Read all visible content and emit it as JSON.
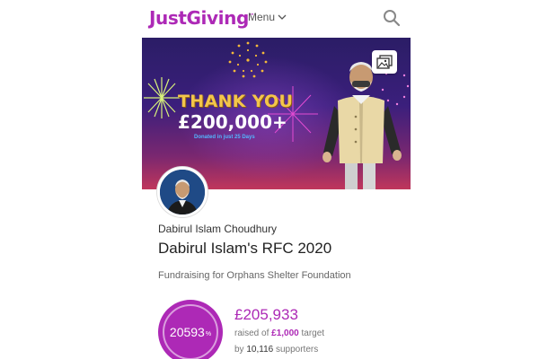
{
  "header": {
    "logo_text": "JustGiving",
    "logo_tm": "™",
    "menu_label": "Menu",
    "brand_color": "#ad29b6",
    "icons": [
      "chevron-down-icon",
      "search-icon"
    ]
  },
  "cover": {
    "headline": "THANK YOU",
    "amount": "£200,000+",
    "note": "Donated in just 25 Days",
    "icons": [
      "gallery-icon"
    ]
  },
  "page": {
    "fundraiser_name": "Dabirul Islam Choudhury",
    "title": "Dabirul Islam's RFC 2020",
    "cause": "Fundraising for Orphans Shelter Foundation"
  },
  "stats": {
    "percent": "20593",
    "percent_sign": "%",
    "raised": "£205,933",
    "raised_prefix": "raised of ",
    "target": "£1,000",
    "target_suffix": " target",
    "supporters_prefix": "by ",
    "supporters_count": "10,116",
    "supporters_suffix": " supporters"
  }
}
